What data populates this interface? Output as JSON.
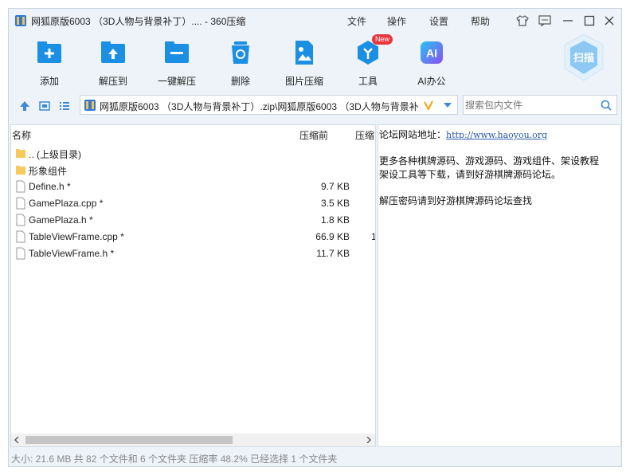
{
  "window": {
    "title": "网狐原版6003 （3D人物与背景补丁）.... - 360压缩",
    "menu": [
      "文件",
      "操作",
      "设置",
      "帮助"
    ]
  },
  "toolbar": {
    "tools": [
      {
        "label": "添加",
        "icon": "add-icon"
      },
      {
        "label": "解压到",
        "icon": "extract-to-icon"
      },
      {
        "label": "一键解压",
        "icon": "one-click-extract-icon"
      },
      {
        "label": "删除",
        "icon": "delete-icon"
      },
      {
        "label": "图片压缩",
        "icon": "image-compress-icon"
      },
      {
        "label": "工具",
        "icon": "tools-icon",
        "badge": "New"
      },
      {
        "label": "AI办公",
        "icon": "ai-office-icon",
        "glyph": "AI"
      }
    ],
    "scan_label": "扫描"
  },
  "address": {
    "path": "网狐原版6003 （3D人物与背景补丁）.zip\\网狐原版6003 （3D人物与背景补",
    "search_placeholder": "搜索包内文件"
  },
  "list": {
    "columns": {
      "name": "名称",
      "compressed_before": "压缩前",
      "compressed": "压缩"
    },
    "rows": [
      {
        "name": ".. (上级目录)",
        "size": "",
        "type": "folder"
      },
      {
        "name": "形象组件",
        "size": "",
        "type": "folder"
      },
      {
        "name": "Define.h *",
        "size": "9.7 KB",
        "type": "file"
      },
      {
        "name": "GamePlaza.cpp *",
        "size": "3.5 KB",
        "type": "file"
      },
      {
        "name": "GamePlaza.h *",
        "size": "1.8 KB",
        "type": "file"
      },
      {
        "name": "TableViewFrame.cpp *",
        "size": "66.9 KB",
        "type": "file",
        "extra": "1"
      },
      {
        "name": "TableViewFrame.h *",
        "size": "11.7 KB",
        "type": "file"
      }
    ]
  },
  "preview": {
    "line1_prefix": "论坛网站地址：",
    "line1_link": "http://www.haoyou.org",
    "line2": "更多各种棋牌源码、游戏源码、游戏组件、架设教程",
    "line3": "架设工具等下载，请到好游棋牌源码论坛。",
    "line4": "解压密码请到好游棋牌源码论坛查找"
  },
  "status": {
    "text": "大小: 21.6 MB 共 82 个文件和 6 个文件夹 压缩率 48.2% 已经选择 1 个文件夹"
  },
  "colors": {
    "accent": "#1a8fe3",
    "window_bg": "#eef3f9",
    "folder": "#f7c95a",
    "badge": "#e8343b"
  }
}
